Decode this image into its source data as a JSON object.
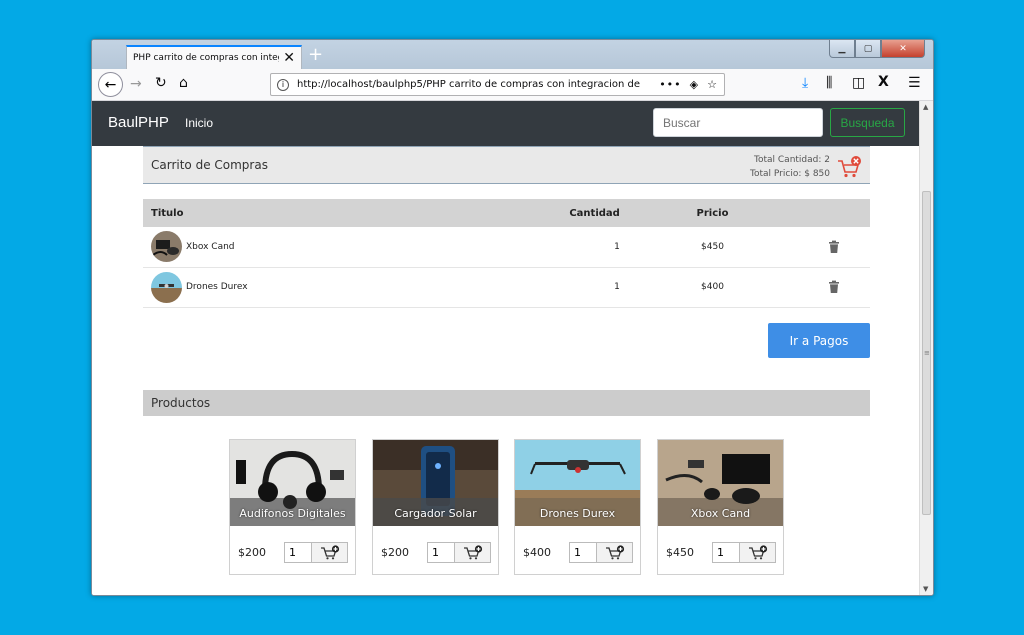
{
  "browser": {
    "tab_title": "PHP carrito de compras con integr",
    "tab_close": "✕",
    "new_tab": "+",
    "url": "http://localhost/baulphp5/PHP carrito de compras con integracion de",
    "page_actions": "•••"
  },
  "app": {
    "brand": "BaulPHP",
    "nav_link": "Inicio",
    "search_placeholder": "Buscar",
    "search_button": "Busqueda"
  },
  "cart": {
    "title": "Carrito de Compras",
    "total_cantidad": "Total Cantidad: 2",
    "total_precio": "Total Pricio: $ 850",
    "columns": {
      "titulo": "Titulo",
      "cantidad": "Cantidad",
      "precio": "Pricio"
    },
    "rows": [
      {
        "name": "Xbox Cand",
        "qty": "1",
        "price": "$450"
      },
      {
        "name": "Drones Durex",
        "qty": "1",
        "price": "$400"
      }
    ],
    "pay_button": "Ir a Pagos"
  },
  "products": {
    "title": "Productos",
    "items": [
      {
        "name": "Audifonos Digitales",
        "price": "$200",
        "qty": "1"
      },
      {
        "name": "Cargador Solar",
        "price": "$200",
        "qty": "1"
      },
      {
        "name": "Drones Durex",
        "price": "$400",
        "qty": "1"
      },
      {
        "name": "Xbox Cand",
        "price": "$450",
        "qty": "1"
      }
    ]
  },
  "colors": {
    "navbar": "#343a40",
    "success": "#28a745",
    "primary": "#3e8ee6",
    "accent": "#0a84ff"
  }
}
